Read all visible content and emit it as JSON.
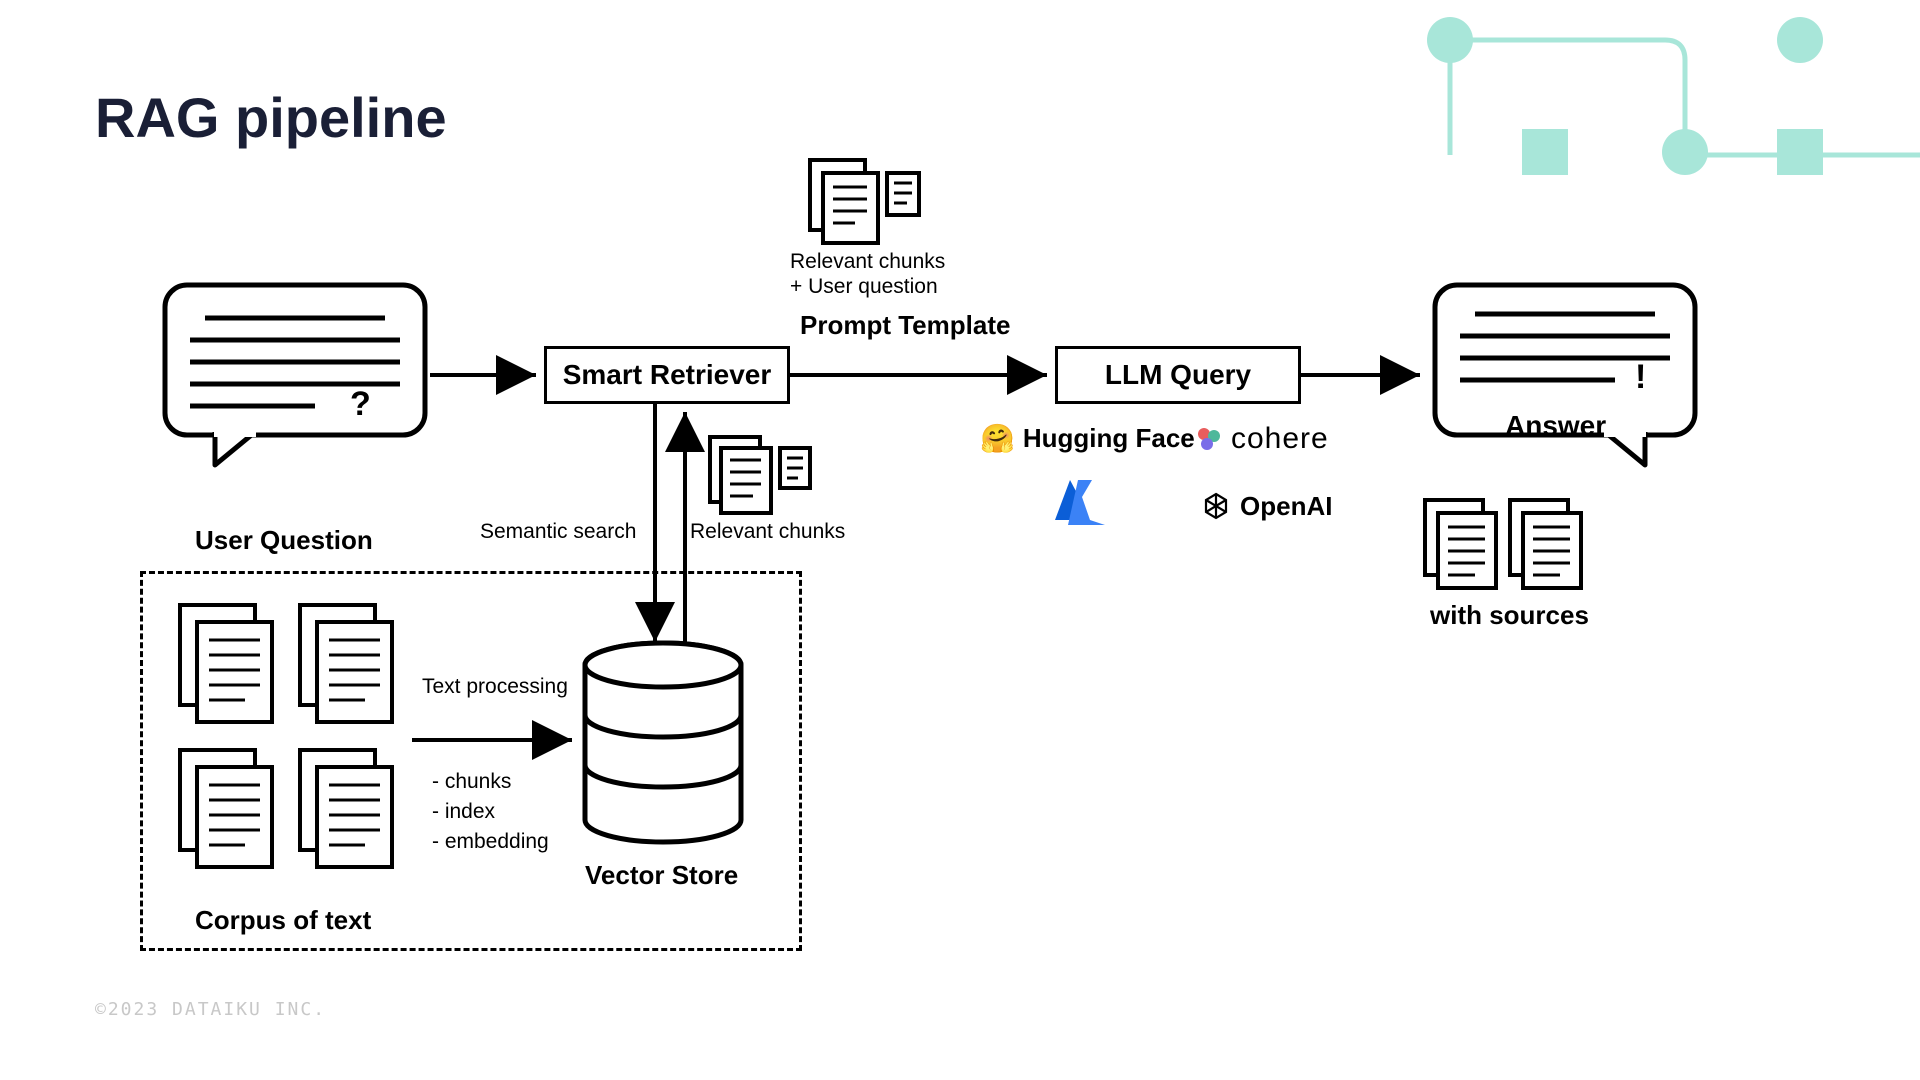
{
  "title": "RAG pipeline",
  "copyright": "©2023 DATAIKU INC.",
  "nodes": {
    "user_question": "User Question",
    "smart_retriever": "Smart Retriever",
    "llm_query": "LLM Query",
    "answer": "Answer",
    "with_sources": "with sources",
    "corpus": "Corpus of text",
    "vector_store": "Vector Store",
    "prompt_template": "Prompt Template",
    "relevant_chunks_uq": "Relevant chunks\n+ User question",
    "relevant_chunks_uq_1": "Relevant chunks",
    "relevant_chunks_uq_2": "+ User question",
    "semantic_search": "Semantic search",
    "relevant_chunks": "Relevant chunks",
    "text_processing": "Text processing",
    "chunks": "- chunks",
    "index": "- index",
    "embedding": "- embedding"
  },
  "providers": {
    "huggingface": "Hugging Face",
    "cohere": "cohere",
    "openai": "OpenAI",
    "azure": "Azure"
  },
  "colors": {
    "accent": "#a8e6d9",
    "dark": "#1a1f36"
  }
}
